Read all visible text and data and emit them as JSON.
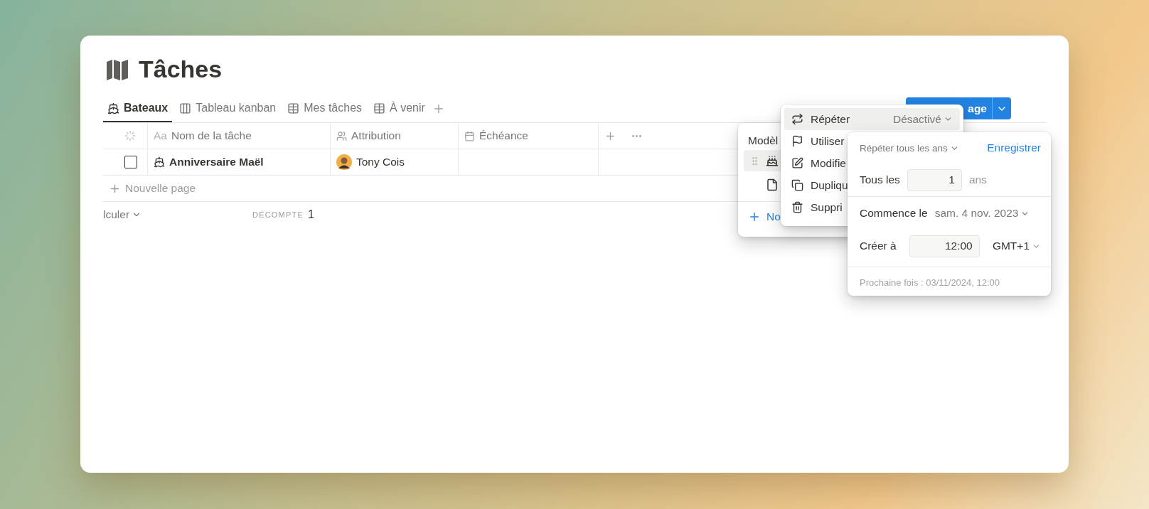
{
  "page": {
    "title": "Tâches"
  },
  "views": [
    {
      "label": "Bateaux",
      "kind": "boat",
      "selected": true
    },
    {
      "label": "Tableau kanban",
      "kind": "board",
      "selected": false
    },
    {
      "label": "Mes tâches",
      "kind": "table",
      "selected": false
    },
    {
      "label": "À venir",
      "kind": "table",
      "selected": false
    }
  ],
  "new_page_button": {
    "label": "age"
  },
  "table": {
    "columns": [
      {
        "label": "Nom de la tâche",
        "prefix": "Aa",
        "kind": "title"
      },
      {
        "label": "Attribution",
        "kind": "person"
      },
      {
        "label": "Échéance",
        "kind": "date"
      }
    ],
    "rows": [
      {
        "checked": false,
        "name": "Anniversaire Maël",
        "assignee": "Tony Cois"
      }
    ],
    "new_row": "Nouvelle page",
    "footer": {
      "calculate": "lculer",
      "count_label": "DÉCOMPTE",
      "count": "1"
    }
  },
  "templates_panel": {
    "title": "Modèl",
    "items": [
      {
        "kind": "cake",
        "selected": true
      },
      {
        "kind": "page",
        "selected": false
      }
    ],
    "new_label": "No"
  },
  "options_menu": {
    "items": [
      {
        "label": "Répéter",
        "value": "Désactivé",
        "kind": "repeat",
        "selected": true
      },
      {
        "label": "Utiliser",
        "kind": "flag",
        "selected": false
      },
      {
        "label": "Modifie",
        "kind": "edit",
        "selected": false
      },
      {
        "label": "Dupliqu",
        "kind": "duplicate",
        "selected": false
      },
      {
        "label": "Suppri",
        "kind": "trash",
        "selected": false
      }
    ]
  },
  "repeat_panel": {
    "frequency": "Répéter tous les ans",
    "save": "Enregistrer",
    "every_label": "Tous les",
    "every_value": "1",
    "every_unit": "ans",
    "start_label": "Commence le",
    "start_value": "sam. 4 nov. 2023",
    "time_label": "Créer à",
    "time_value": "12:00",
    "timezone": "GMT+1",
    "next": "Prochaine fois : 03/11/2024, 12:00"
  }
}
